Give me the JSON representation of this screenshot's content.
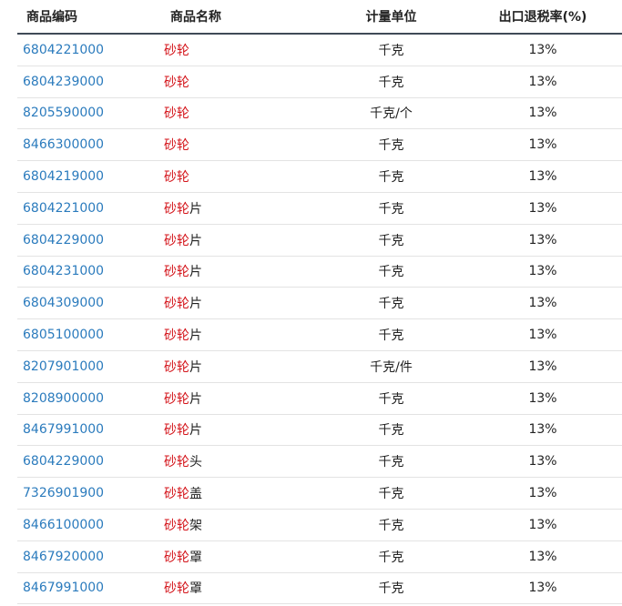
{
  "table": {
    "headers": {
      "code": "商品编码",
      "name": "商品名称",
      "unit": "计量单位",
      "rate": "出口退税率(%)"
    },
    "highlight_term": "砂轮",
    "rows": [
      {
        "code": "6804221000",
        "name_hl": "砂轮",
        "name_rest": "",
        "unit": "千克",
        "rate": "13%"
      },
      {
        "code": "6804239000",
        "name_hl": "砂轮",
        "name_rest": "",
        "unit": "千克",
        "rate": "13%"
      },
      {
        "code": "8205590000",
        "name_hl": "砂轮",
        "name_rest": "",
        "unit": "千克/个",
        "rate": "13%"
      },
      {
        "code": "8466300000",
        "name_hl": "砂轮",
        "name_rest": "",
        "unit": "千克",
        "rate": "13%"
      },
      {
        "code": "6804219000",
        "name_hl": "砂轮",
        "name_rest": "",
        "unit": "千克",
        "rate": "13%"
      },
      {
        "code": "6804221000",
        "name_hl": "砂轮",
        "name_rest": "片",
        "unit": "千克",
        "rate": "13%"
      },
      {
        "code": "6804229000",
        "name_hl": "砂轮",
        "name_rest": "片",
        "unit": "千克",
        "rate": "13%"
      },
      {
        "code": "6804231000",
        "name_hl": "砂轮",
        "name_rest": "片",
        "unit": "千克",
        "rate": "13%"
      },
      {
        "code": "6804309000",
        "name_hl": "砂轮",
        "name_rest": "片",
        "unit": "千克",
        "rate": "13%"
      },
      {
        "code": "6805100000",
        "name_hl": "砂轮",
        "name_rest": "片",
        "unit": "千克",
        "rate": "13%"
      },
      {
        "code": "8207901000",
        "name_hl": "砂轮",
        "name_rest": "片",
        "unit": "千克/件",
        "rate": "13%"
      },
      {
        "code": "8208900000",
        "name_hl": "砂轮",
        "name_rest": "片",
        "unit": "千克",
        "rate": "13%"
      },
      {
        "code": "8467991000",
        "name_hl": "砂轮",
        "name_rest": "片",
        "unit": "千克",
        "rate": "13%"
      },
      {
        "code": "6804229000",
        "name_hl": "砂轮",
        "name_rest": "头",
        "unit": "千克",
        "rate": "13%"
      },
      {
        "code": "7326901900",
        "name_hl": "砂轮",
        "name_rest": "盖",
        "unit": "千克",
        "rate": "13%"
      },
      {
        "code": "8466100000",
        "name_hl": "砂轮",
        "name_rest": "架",
        "unit": "千克",
        "rate": "13%"
      },
      {
        "code": "8467920000",
        "name_hl": "砂轮",
        "name_rest": "罩",
        "unit": "千克",
        "rate": "13%"
      },
      {
        "code": "8467991000",
        "name_hl": "砂轮",
        "name_rest": "罩",
        "unit": "千克",
        "rate": "13%"
      }
    ]
  },
  "colors": {
    "link": "#2b7bbd",
    "highlight": "#d4151b",
    "text": "#222222",
    "header_rule": "#3f4a57",
    "row_rule": "#e3e3e3"
  }
}
